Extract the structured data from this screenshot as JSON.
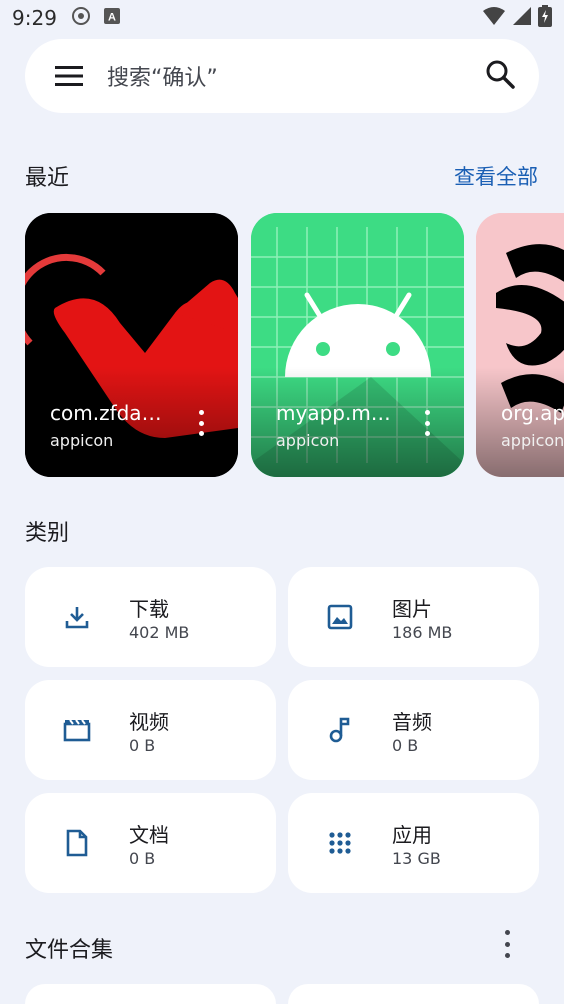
{
  "status_bar": {
    "time": "9:29"
  },
  "search": {
    "placeholder": "搜索“确认”"
  },
  "recent": {
    "title": "最近",
    "view_all": "查看全部",
    "cards": [
      {
        "title": "com.zfda…",
        "subtitle": "appicon"
      },
      {
        "title": "myapp.m…",
        "subtitle": "appicon"
      },
      {
        "title": "org.ap",
        "subtitle": "appicon"
      }
    ]
  },
  "categories": {
    "title": "类别",
    "items": [
      {
        "name": "下载",
        "size": "402 MB",
        "icon": "download-icon"
      },
      {
        "name": "图片",
        "size": "186 MB",
        "icon": "image-icon"
      },
      {
        "name": "视频",
        "size": "0 B",
        "icon": "video-icon"
      },
      {
        "name": "音频",
        "size": "0 B",
        "icon": "music-note-icon"
      },
      {
        "name": "文档",
        "size": "0 B",
        "icon": "document-icon"
      },
      {
        "name": "应用",
        "size": "13 GB",
        "icon": "apps-grid-icon"
      }
    ]
  },
  "collections": {
    "title": "文件合集"
  },
  "colors": {
    "accent": "#1a5fb4",
    "icon_blue": "#1f5c94",
    "background": "#eff2fa"
  }
}
